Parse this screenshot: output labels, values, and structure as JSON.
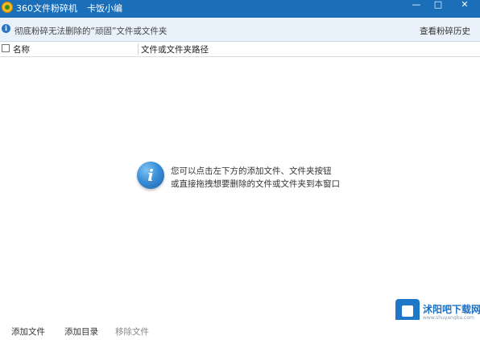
{
  "window": {
    "title": "360文件粉碎机",
    "subtitle": "卡饭小编",
    "minimize": "—",
    "maximize": "□",
    "close": "✕"
  },
  "infobar": {
    "icon": "info-icon",
    "text": "彻底粉碎无法删除的“顽固”文件或文件夹",
    "history_link": "查看粉碎历史"
  },
  "table": {
    "columns": [
      "名称",
      "文件或文件夹路径"
    ],
    "rows": []
  },
  "empty_state": {
    "icon": "info-circle-icon",
    "line1": "您可以点击左下方的添加文件、文件夹按钮",
    "line2": "或直接拖拽想要删除的文件或文件夹到本窗口"
  },
  "bottom": {
    "add_file": "添加文件",
    "add_dir": "添加目录",
    "remove_file": "移除文件"
  },
  "watermark": {
    "name": "沭阳吧下载网",
    "url": "www.shuyangba.com"
  },
  "colors": {
    "titlebar": "#1a6fb8",
    "infobar": "#e9f2fb",
    "accent": "#2a73c0"
  }
}
